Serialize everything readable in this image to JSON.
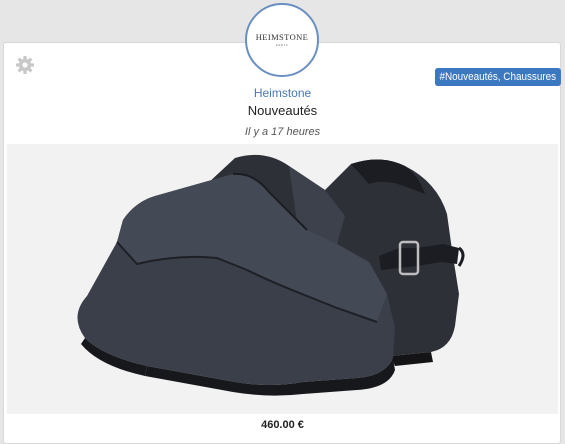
{
  "brand": {
    "name": "Heimstone",
    "logo_text": "HEIMSTONE",
    "logo_subtext": "PARIS"
  },
  "post": {
    "category": "Nouveautés",
    "time_ago": "Il y a 17 heures",
    "tags": "#Nouveautés, Chaussures",
    "price": "460.00 €"
  },
  "icons": {
    "settings": "gear-icon"
  },
  "colors": {
    "accent": "#3c78c0",
    "brand_link": "#4a78b8",
    "background": "#e6e6e6",
    "shoe": "#3b3f4a"
  }
}
